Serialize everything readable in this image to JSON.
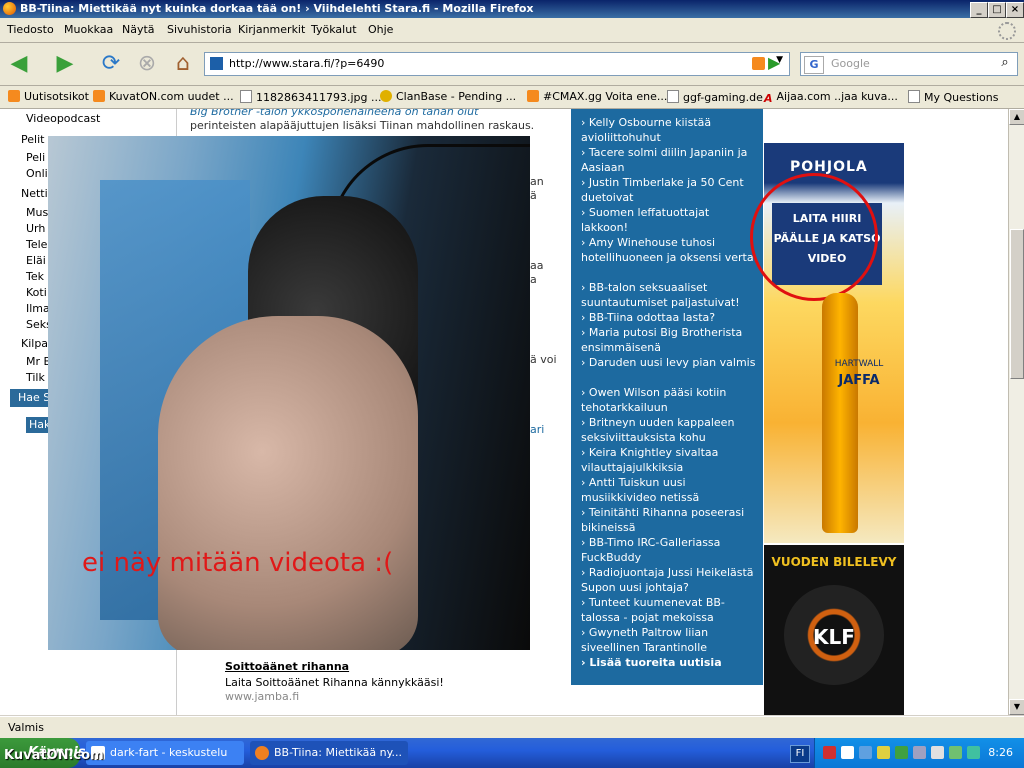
{
  "window": {
    "title": "BB-Tiina: Miettikää nyt kuinka dorkaa tää on! › Viihdelehti Stara.fi  - Mozilla Firefox",
    "buttons": {
      "minimize": "_",
      "maximize": "□",
      "close": "×"
    }
  },
  "menu": [
    "Tiedosto",
    "Muokkaa",
    "Näytä",
    "Sivuhistoria",
    "Kirjanmerkit",
    "Työkalut",
    "Ohje"
  ],
  "nav": {
    "url": "http://www.stara.fi/?p=6490",
    "search_placeholder": "Google",
    "search_engine_letter": "G"
  },
  "bookmarks": [
    {
      "label": "Uutisotsikot",
      "icon": "rss-icon"
    },
    {
      "label": "KuvatON.com uudet ...",
      "icon": "rss-icon"
    },
    {
      "label": "1182863411793.jpg ...",
      "icon": "page-icon"
    },
    {
      "label": "ClanBase - Pending ...",
      "icon": "link-icon"
    },
    {
      "label": "#CMAX.gg Voita ene...",
      "icon": "rss-icon"
    },
    {
      "label": "ggf-gaming.de",
      "icon": "page-icon"
    },
    {
      "label": "Aijaa.com ..jaa kuva...",
      "icon": "a-icon"
    },
    {
      "label": "My Questions",
      "icon": "page-icon"
    }
  ],
  "left": {
    "links": [
      "Videopodcast",
      "Pelit",
      "Peli",
      "Onli",
      "Nettiv",
      "Mus",
      "Urh",
      "Tele",
      "Eläi",
      "Tek",
      "Koti",
      "Ilma",
      "Seks",
      "Kilpa",
      "Mr B",
      "Tilk"
    ],
    "search_bar": "Hae S",
    "search_button": "Hak"
  },
  "article": {
    "lines": [
      "Big Brother -talon ykkösponenaiheena on tähän olut",
      "perinteisten alapääjuttujen lisäksi Tiinan mahdollinen raskaus."
    ],
    "fragments": [
      "an",
      "ä",
      "aa",
      "a",
      "ä voi",
      "ari"
    ],
    "ad_title": "Soittoäänet rihanna",
    "ad_text": "Laita Soittoäänet Rihanna kännykkääsi!",
    "ad_url": "www.jamba.fi"
  },
  "news": [
    "Kelly Osbourne kiistää avioliittohuhut",
    "Tacere solmi diilin Japaniin ja Aasiaan",
    "Justin Timberlake ja 50 Cent duetoivat",
    "Suomen leffatuottajat lakkoon!",
    "Amy Winehouse tuhosi hotellihuoneen ja oksensi verta",
    "BB-talon seksuaaliset suuntautumiset paljastuivat!",
    "BB-Tiina odottaa lasta?",
    "Maria putosi Big Brotherista ensimmäisenä",
    "Daruden uusi levy pian valmis",
    "Owen Wilson pääsi kotiin tehotarkkailuun",
    "Britneyn uuden kappaleen seksiviittauksista kohu",
    "Keira Knightley sivaltaa vilauttajajulkkiksia",
    "Antti Tuiskun uusi musiikkivideo netissä",
    "Teinitähti Rihanna poseerasi bikineissä",
    "BB-Timo IRC-Galleriassa FuckBuddy",
    "Radiojuontaja Jussi Heikelästä Supon uusi johtaja?",
    "Tunteet kuumenevat BB-talossa - pojat mekoissa",
    "Gwyneth Paltrow liian siveellinen Tarantinolle"
  ],
  "news_more": "Lisää tuoreita uutisia",
  "ads": {
    "brand": "POHJOLA",
    "hint": "LAITA HIIRI PÄÄLLE JA KATSO VIDEO",
    "bottle_top": "HARTWALL",
    "bottle_name": "JAFFA",
    "record_title": "VUODEN BILELEVY",
    "record_name": "KLF"
  },
  "photo_caption": "ei näy mitään videota :(",
  "status": "Valmis",
  "taskbar": {
    "start": "Käynnistä",
    "tasks": [
      "dark-fart - keskustelu",
      "BB-Tiina: Miettikää ny..."
    ],
    "lang": "FI",
    "clock": "8:26"
  },
  "watermark": "KuvatON.com",
  "colors": {
    "accent": "#1d6aa0",
    "caption": "#e01818",
    "titlebar": "#0a246a"
  }
}
